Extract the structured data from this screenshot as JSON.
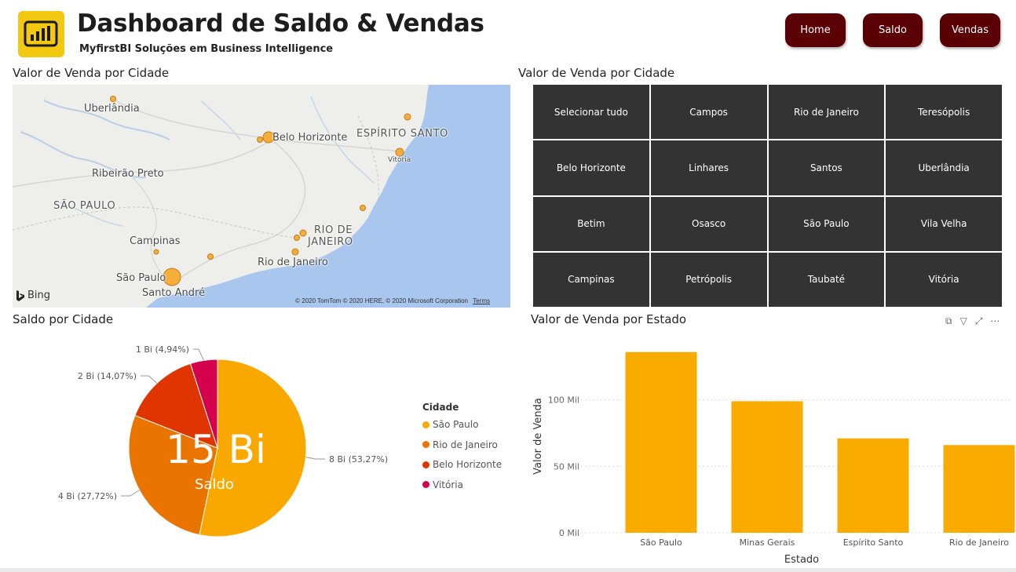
{
  "header": {
    "title": "Dashboard de Saldo & Vendas",
    "subtitle": "MyfirstBI Soluções em Business Intelligence",
    "logo_icon": "power-bi-logo-icon",
    "nav": [
      {
        "label": "Home"
      },
      {
        "label": "Saldo"
      },
      {
        "label": "Vendas"
      }
    ]
  },
  "map_panel": {
    "title": "Valor de Venda por Cidade",
    "labels": {
      "uberlandia": "Uberlândia",
      "belo_horizonte": "Belo Horizonte",
      "espirito_santo": "ESPÍRITO SANTO",
      "vitoria": "Vitória",
      "ribeirao_preto": "Ribeirão Preto",
      "sao_paulo_state": "SÃO PAULO",
      "rio_de_janeiro_state_1": "RIO DE",
      "rio_de_janeiro_state_2": "JANEIRO",
      "campinas": "Campinas",
      "rio_de_janeiro_city": "Rio de Janeiro",
      "sao_paulo_city": "São Paulo",
      "santo_andre": "Santo André"
    },
    "bing": "Bing",
    "copyright": "© 2020 TomTom © 2020 HERE, © 2020 Microsoft Corporation",
    "terms": "Terms"
  },
  "slicer_panel": {
    "title": "Valor de Venda por Cidade",
    "items": [
      "Selecionar tudo",
      "Campos",
      "Rio de Janeiro",
      "Teresópolis",
      "Belo Horizonte",
      "Linhares",
      "Santos",
      "Uberlândia",
      "Betim",
      "Osasco",
      "São Paulo",
      "Vila Velha",
      "Campinas",
      "Petrópolis",
      "Taubaté",
      "Vitória"
    ]
  },
  "pie_panel": {
    "title": "Saldo por Cidade",
    "center_value": "15 Bi",
    "center_label": "Saldo",
    "legend_title": "Cidade",
    "slices": [
      {
        "name": "São Paulo",
        "percent": 53.27,
        "label": "8 Bi (53,27%)",
        "color": "#f9a800"
      },
      {
        "name": "Rio de Janeiro",
        "percent": 27.72,
        "label": "4 Bi (27,72%)",
        "color": "#e97500"
      },
      {
        "name": "Belo Horizonte",
        "percent": 14.07,
        "label": "2 Bi (14,07%)",
        "color": "#e03500"
      },
      {
        "name": "Vitória",
        "percent": 4.94,
        "label": "1 Bi (4,94%)",
        "color": "#d4004c"
      }
    ]
  },
  "bar_panel": {
    "title": "Valor de Venda por Estado",
    "header_icons": [
      "copy-icon",
      "filter-icon",
      "expand-icon",
      "more-icon"
    ]
  },
  "chart_data": {
    "type": "bar",
    "title": "Valor de Venda por Estado",
    "xlabel": "Estado",
    "ylabel": "Valor de Venda",
    "categories": [
      "São Paulo",
      "Minas Gerais",
      "Espírito Santo",
      "Rio de Janeiro"
    ],
    "values": [
      136,
      99,
      71,
      66
    ],
    "unit": "Mil",
    "ylim": [
      0,
      150
    ],
    "yticks": [
      0,
      50,
      100
    ],
    "ytick_labels": [
      "0 Mil",
      "50 Mil",
      "100 Mil"
    ],
    "color": "#f9ab00",
    "grid": true
  },
  "colors": {
    "nav_button": "#5a0005",
    "slicer_tile": "#333333",
    "bar": "#f9ab00",
    "map_water": "#a9c6ef",
    "map_marker": "#f5a623"
  }
}
